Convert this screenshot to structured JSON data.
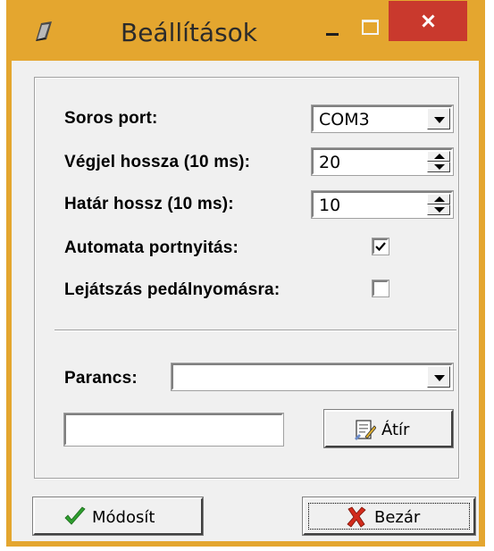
{
  "window": {
    "title": "Beállítások",
    "colors": {
      "frame": "#e4a62f",
      "close": "#c9392d",
      "client": "#f0f0f0"
    }
  },
  "settings": {
    "serial_port_label": "Soros port:",
    "serial_port_value": "COM3",
    "end_signal_label": "Végjel hossza (10 ms):",
    "end_signal_value": "20",
    "limit_label": "Határ hossz (10 ms):",
    "limit_value": "10",
    "auto_open_label": "Automata portnyitás:",
    "auto_open_checked": true,
    "pedal_play_label": "Lejátszás pedálnyomásra:",
    "pedal_play_checked": false
  },
  "command": {
    "label": "Parancs:",
    "value": "",
    "text_value": "",
    "rewrite_label": "Átír"
  },
  "footer": {
    "modify_label": "Módosít",
    "close_label": "Bezár"
  },
  "icons": {
    "app": "pencil-eraser-icon",
    "modify": "green-check-icon",
    "close": "red-x-icon",
    "rewrite": "document-edit-icon"
  }
}
